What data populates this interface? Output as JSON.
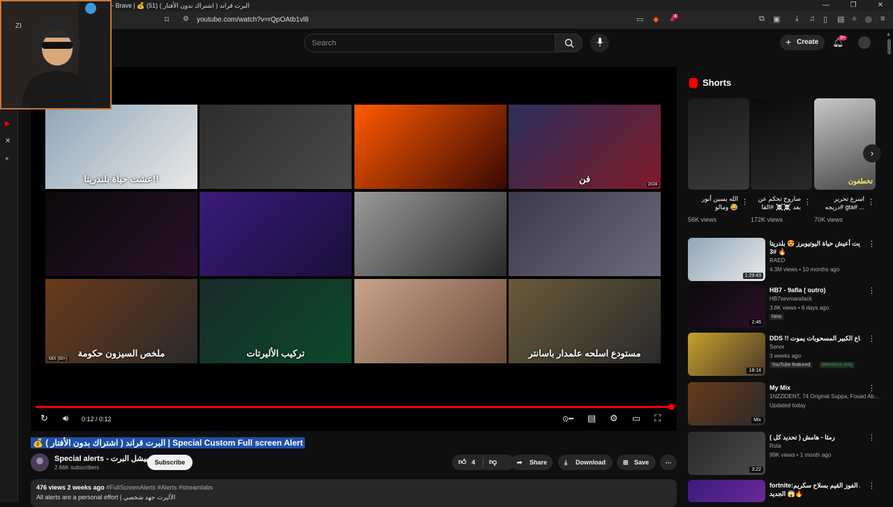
{
  "browser": {
    "window_title": "- Brave | 💰 البرت قراند ( اشتراك بدون الأفتار ) (51)",
    "url": "youtube.com/watch?v=rQpOAtb1vl8",
    "ext_badge": "4"
  },
  "overlay": {
    "webcam_label": "ZI"
  },
  "header": {
    "search_placeholder": "Search",
    "create_label": "Create",
    "notif_count": "9+"
  },
  "player": {
    "thumbnails": [
      {
        "caption": "عشت حياة بلندريتا!!",
        "colors": [
          "#8fa6b8",
          "#e9e9e9"
        ]
      },
      {
        "caption": "",
        "colors": [
          "#2d2d2d",
          "#4a4a4a"
        ]
      },
      {
        "caption": "",
        "colors": [
          "#ff5a00",
          "#3a0800"
        ]
      },
      {
        "caption": "فن",
        "colors": [
          "#2b2f5a",
          "#7f1a28"
        ],
        "badge": "2024"
      },
      {
        "caption": "",
        "colors": [
          "#0a0a0a",
          "#2a0f2a"
        ]
      },
      {
        "caption": "",
        "colors": [
          "#3a1a7a",
          "#1a0f3a"
        ]
      },
      {
        "caption": "",
        "colors": [
          "#9a9a9a",
          "#2a2a2a"
        ]
      },
      {
        "caption": "",
        "colors": [
          "#3a3a4a",
          "#6a6a7a"
        ]
      },
      {
        "caption": "ملخص السيزون حكومة",
        "colors": [
          "#6a3a1a",
          "#2a2a2a"
        ],
        "mix": "MIX (50+)"
      },
      {
        "caption": "تركيب الأليرتات",
        "colors": [
          "#1a2a2a",
          "#0a4a2a"
        ]
      },
      {
        "caption": "",
        "colors": [
          "#c8a48a",
          "#6a4a3a"
        ]
      },
      {
        "caption": "مستودع اسلحه علمدار باسانتر",
        "colors": [
          "#6a5a3a",
          "#2a2a2a"
        ]
      }
    ],
    "time": "0:12 / 0:12",
    "progress": 1.0
  },
  "video": {
    "title": "💰 البرت قراند ( اشتراك بدون الأفتار ) | Special Custom Full screen Alert",
    "channel_name": "Special alerts - سبيشل البرت",
    "subscribers": "2.66K subscribers",
    "subscribe_label": "Subscribe",
    "likes": "4",
    "share_label": "Share",
    "download_label": "Download",
    "save_label": "Save",
    "desc_stats": "476 views  2 weeks ago",
    "desc_tags": "#FullScreenAlerts #Alerts #streamlabs",
    "desc_line2": "All alerts are a personal effort | الأليرت جهد شخصي"
  },
  "shorts": {
    "heading": "Shorts",
    "items": [
      {
        "title": "الله يسين أنور ومالو 😂",
        "views": "56K views",
        "colors": [
          "#1a1a1a",
          "#3a3a3a"
        ]
      },
      {
        "title": "صاروخ تحكم عن بعد ☠️☠️ #القا",
        "views": "172K views",
        "colors": [
          "#0a0a0a",
          "#2a2a2a"
        ]
      },
      {
        "title": "اسرع تحرير #دريجه gta# ...",
        "views": "70K views",
        "colors": [
          "#c8c8c8",
          "#4a4a4a"
        ],
        "overlay": "تخطفون"
      }
    ]
  },
  "recommendations": [
    {
      "title": "جربت أعيش حياة اليوتيوبرز 😍 بلدريتا",
      "title2": "3# 🔥",
      "channel": "RAED",
      "meta": "4.3M views • 10 months ago",
      "duration": "1:29:43",
      "colors": [
        "#8fa6b8",
        "#e9e9e9"
      ]
    },
    {
      "title": "HB7 - 9afla ( outro)",
      "title2": "",
      "channel": "HB7sevmarafack",
      "meta": "3.8K views • 6 days ago",
      "duration": "2:46",
      "badge": "New",
      "colors": [
        "#0a0a0a",
        "#2a0f2a"
      ]
    },
    {
      "title": "DDS !! البياع الكبير المسحوبات يموت",
      "title2": "",
      "channel": "Senor",
      "meta": "3 weeks ago",
      "duration": "18:14",
      "badge": "YouTube featured",
      "badge2": "Members only",
      "colors": [
        "#c8a02a",
        "#4a3a2a"
      ]
    },
    {
      "title": "My Mix",
      "title2": "",
      "channel": "1NZZiDENT, 74 Original Suppa, Fouad Ab...",
      "meta": "Updated today",
      "duration": "Mix",
      "colors": [
        "#6a3a1a",
        "#2a2a2a"
      ]
    },
    {
      "title": "رمثا - هامش ( تحديد كل )",
      "title2": "",
      "channel": "Rsta",
      "meta": "99K views • 1 month ago",
      "duration": "3:22",
      "colors": [
        "#2a2a2a",
        "#4a4a4a"
      ]
    },
    {
      "title": "fortnite:تحدي الفوز القيم بسلاح سكريم",
      "title2": "الجديد 😱🔥",
      "channel": "",
      "meta": "",
      "duration": "",
      "colors": [
        "#3a1a7a",
        "#6a2a9a"
      ]
    }
  ]
}
